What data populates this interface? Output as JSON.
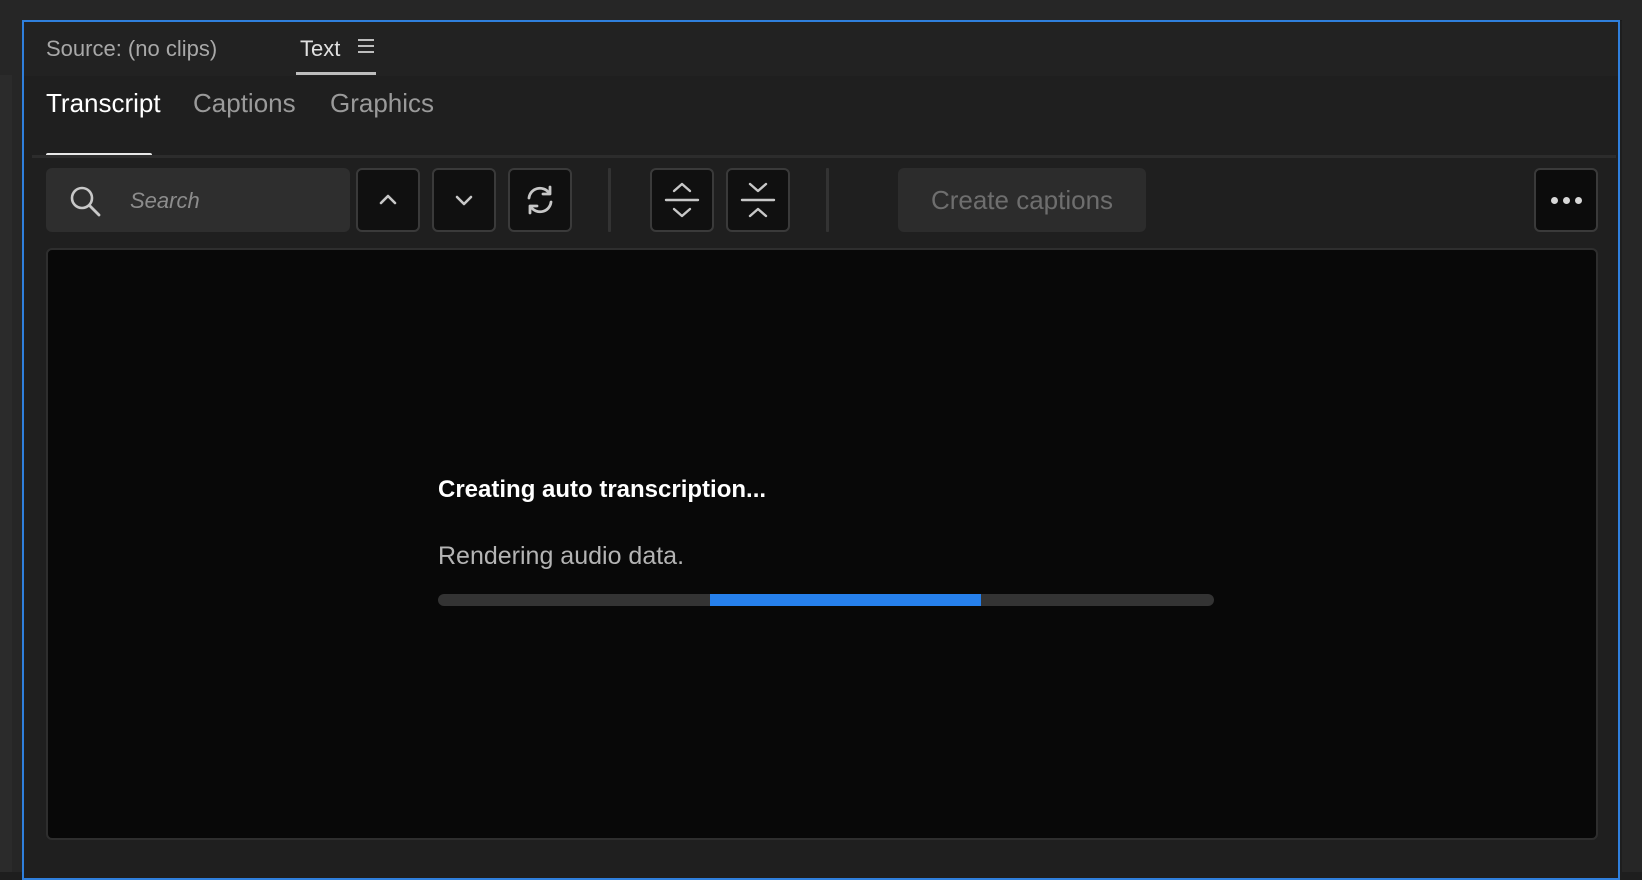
{
  "panel": {
    "source_label": "Source: (no clips)",
    "active_panel_tab": "Text"
  },
  "subtabs": [
    {
      "label": "Transcript",
      "active": true
    },
    {
      "label": "Captions",
      "active": false
    },
    {
      "label": "Graphics",
      "active": false
    }
  ],
  "toolbar": {
    "search_placeholder": "Search",
    "search_value": "",
    "create_captions_label": "Create captions",
    "icons": {
      "search": "search-icon",
      "previous": "chevron-up-icon",
      "next": "chevron-down-icon",
      "refresh": "refresh-icon",
      "expand": "expand-vertical-icon",
      "collapse": "collapse-vertical-icon",
      "more": "more-icon"
    }
  },
  "status": {
    "title": "Creating auto transcription...",
    "message": "Rendering audio data.",
    "progress_segment": {
      "start": 0.35,
      "end": 0.7
    }
  },
  "colors": {
    "accent": "#2680eb",
    "panel_border": "#2f7fdc"
  }
}
